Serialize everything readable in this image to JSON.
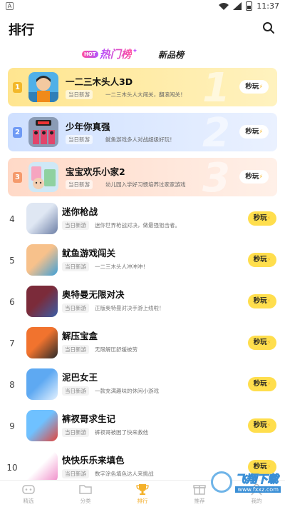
{
  "status": {
    "a": "A",
    "time": "11:37"
  },
  "header": {
    "title": "排行"
  },
  "tabs": {
    "hot_pill": "HOT",
    "hot_label": "热门榜",
    "new_label": "新品榜"
  },
  "top": [
    {
      "rank": "1",
      "big": "1",
      "name": "一二三木头人3D",
      "tag": "当日新游",
      "desc": "一二三木头人大闯关，翻滚闯关！",
      "btn": "秒玩"
    },
    {
      "rank": "2",
      "big": "2",
      "name": "少年你真强",
      "tag": "当日新游",
      "desc": "鱿鱼游戏多人对战超级好玩！",
      "btn": "秒玩"
    },
    {
      "rank": "3",
      "big": "3",
      "name": "宝宝欢乐小家2",
      "tag": "当日新游",
      "desc": "幼儿园入学好习惯培养过家家游戏",
      "btn": "秒玩"
    }
  ],
  "rows": [
    {
      "num": "4",
      "name": "迷你枪战",
      "tag": "当日新游",
      "desc": "迷你世界枪战对决，做最强狙击者。",
      "btn": "秒玩",
      "colors": [
        "#dfe7f3",
        "#6d7fa6"
      ]
    },
    {
      "num": "5",
      "name": "鱿鱼游戏闯关",
      "tag": "当日新游",
      "desc": "一二三木头人冲冲冲！",
      "btn": "秒玩",
      "colors": [
        "#f7c18b",
        "#3fa0d8"
      ]
    },
    {
      "num": "6",
      "name": "奥特曼无限对决",
      "tag": "当日新游",
      "desc": "正版奥特曼对决手游上线啦！",
      "btn": "秒玩",
      "colors": [
        "#7b2b3a",
        "#3a5ea8"
      ]
    },
    {
      "num": "7",
      "name": "解压宝盒",
      "tag": "当日新游",
      "desc": "无限解压舒缓被劳",
      "btn": "秒玩",
      "colors": [
        "#f1732e",
        "#2b2b2b"
      ]
    },
    {
      "num": "8",
      "name": "泥巴女王",
      "tag": "当日新游",
      "desc": "一款充满趣味的休闲小游戏",
      "btn": "秒玩",
      "colors": [
        "#5ea9f2",
        "#e3f1ff"
      ]
    },
    {
      "num": "9",
      "name": "裤衩哥求生记",
      "tag": "当日新游",
      "desc": "裤衩哥被困了快来救他",
      "btn": "秒玩",
      "colors": [
        "#6fc1ff",
        "#e2453d"
      ]
    },
    {
      "num": "10",
      "name": "快快乐乐来填色",
      "tag": "当日新游",
      "desc": "数字涂色填色达人来挑战",
      "btn": "秒玩",
      "colors": [
        "#ffffff",
        "#f08bc8"
      ]
    }
  ],
  "nav": [
    {
      "label": "精选"
    },
    {
      "label": "分类"
    },
    {
      "label": "排行"
    },
    {
      "label": "推荐"
    },
    {
      "label": "我的"
    }
  ],
  "watermark": {
    "text1": "飞翔下载",
    "text2": "www.fxxz.com"
  }
}
